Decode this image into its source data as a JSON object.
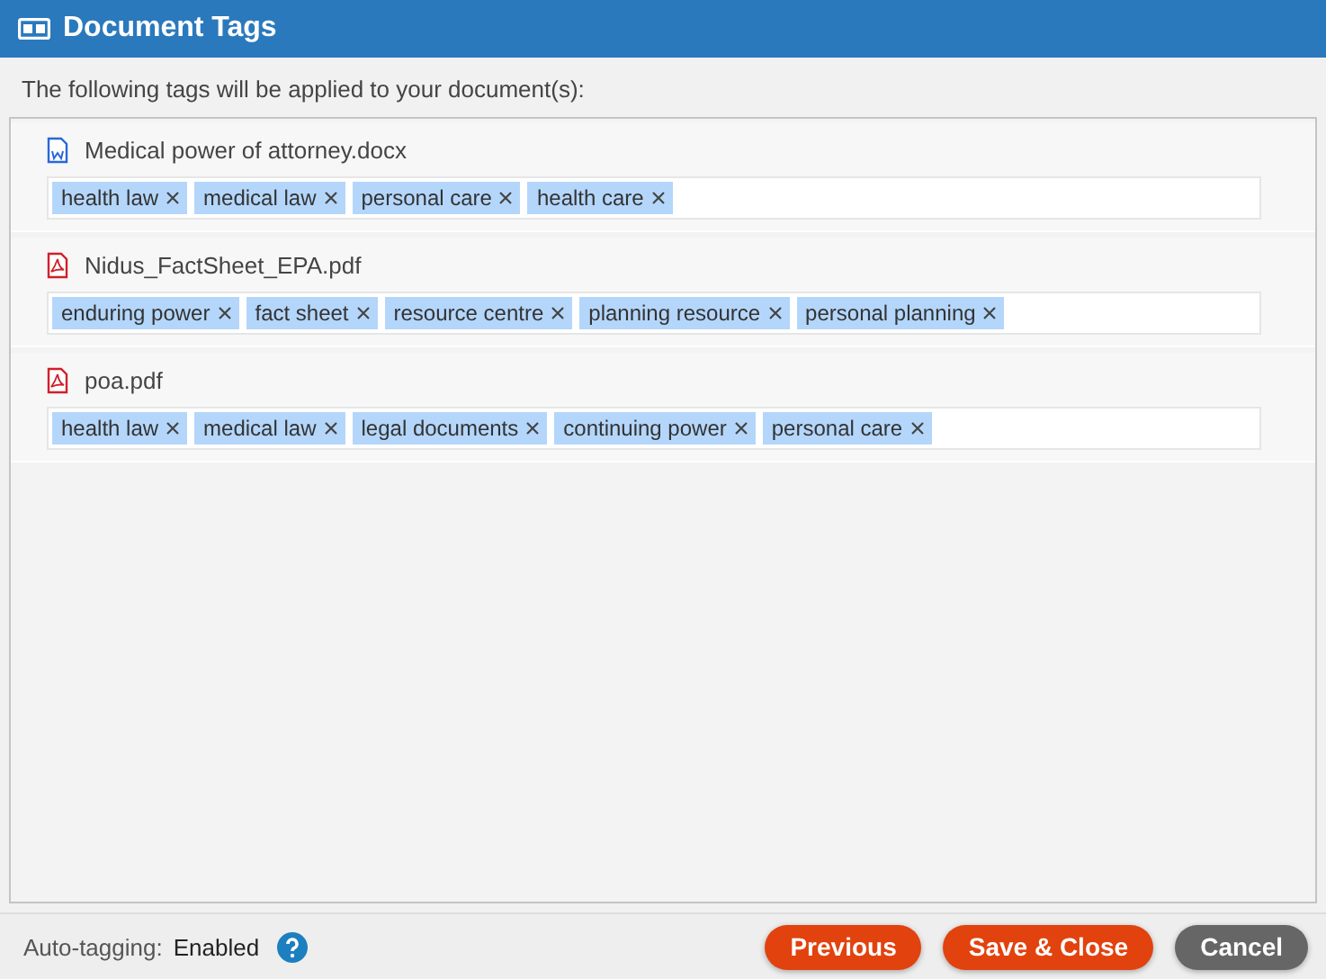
{
  "window": {
    "title": "Document Tags"
  },
  "intro": "The following tags will be applied to your document(s):",
  "documents": [
    {
      "kind": "word",
      "name": "Medical power of attorney.docx",
      "tags": [
        "health law",
        "medical law",
        "personal care",
        "health care"
      ]
    },
    {
      "kind": "pdf",
      "name": "Nidus_FactSheet_EPA.pdf",
      "tags": [
        "enduring power",
        "fact sheet",
        "resource centre",
        "planning resource",
        "personal planning"
      ]
    },
    {
      "kind": "pdf",
      "name": "poa.pdf",
      "tags": [
        "health law",
        "medical law",
        "legal documents",
        "continuing power",
        "personal care"
      ]
    }
  ],
  "footer": {
    "label": "Auto-tagging:",
    "value": "Enabled"
  },
  "buttons": [
    {
      "label": "Previous",
      "kind": "primary"
    },
    {
      "label": "Save & Close",
      "kind": "primary"
    },
    {
      "label": "Cancel",
      "kind": "secondary"
    }
  ]
}
